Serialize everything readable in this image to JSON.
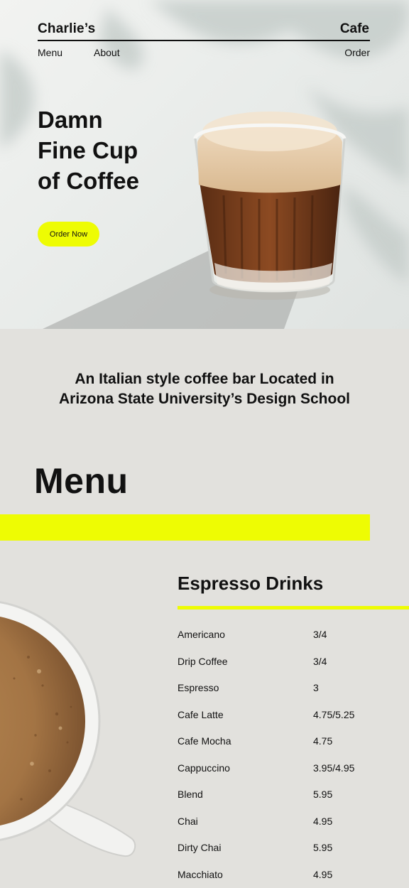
{
  "header": {
    "brand_left": "Charlie’s",
    "brand_right": "Cafe",
    "nav": {
      "menu": "Menu",
      "about": "About",
      "order": "Order"
    }
  },
  "hero": {
    "title_lines": [
      "Damn",
      "Fine Cup",
      "of Coffee"
    ],
    "cta": "Order Now"
  },
  "tagline": {
    "line1": "An Italian style coffee bar Located in",
    "line2": "Arizona State University’s Design School"
  },
  "menu": {
    "heading": "Menu",
    "section_title": "Espresso Drinks",
    "items": [
      {
        "name": "Americano",
        "price": "3/4"
      },
      {
        "name": "Drip Coffee",
        "price": "3/4"
      },
      {
        "name": "Espresso",
        "price": "3"
      },
      {
        "name": "Cafe Latte",
        "price": "4.75/5.25"
      },
      {
        "name": "Cafe Mocha",
        "price": "4.75"
      },
      {
        "name": "Cappuccino",
        "price": "3.95/4.95"
      },
      {
        "name": "Blend",
        "price": "5.95"
      },
      {
        "name": "Chai",
        "price": "4.95"
      },
      {
        "name": "Dirty Chai",
        "price": "5.95"
      },
      {
        "name": "Macchiato",
        "price": "4.95"
      }
    ]
  },
  "colors": {
    "accent": "#eefc03",
    "background": "#e2e1dd",
    "text": "#111111"
  }
}
